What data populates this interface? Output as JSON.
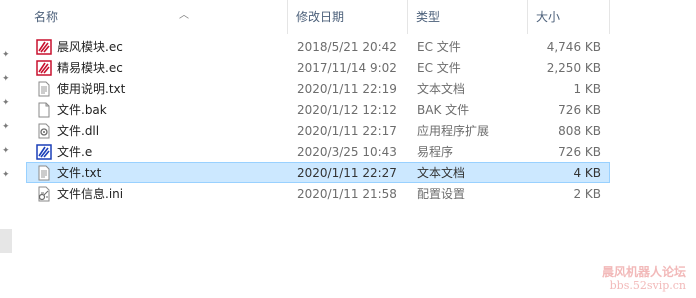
{
  "columns": {
    "name": "名称",
    "date": "修改日期",
    "type": "类型",
    "size": "大小"
  },
  "files": [
    {
      "name": "晨风模块.ec",
      "date": "2018/5/21 20:42",
      "type": "EC 文件",
      "size": "4,746 KB",
      "icon": "ec-module-icon",
      "selected": false
    },
    {
      "name": "精易模块.ec",
      "date": "2017/11/14 9:02",
      "type": "EC 文件",
      "size": "2,250 KB",
      "icon": "ec-module-icon",
      "selected": false
    },
    {
      "name": "使用说明.txt",
      "date": "2020/1/11 22:19",
      "type": "文本文档",
      "size": "1 KB",
      "icon": "text-document-icon",
      "selected": false
    },
    {
      "name": "文件.bak",
      "date": "2020/1/12 12:12",
      "type": "BAK 文件",
      "size": "726 KB",
      "icon": "blank-file-icon",
      "selected": false
    },
    {
      "name": "文件.dll",
      "date": "2020/1/11 22:17",
      "type": "应用程序扩展",
      "size": "808 KB",
      "icon": "dll-gear-icon",
      "selected": false
    },
    {
      "name": "文件.e",
      "date": "2020/3/25 10:43",
      "type": "易程序",
      "size": "726 KB",
      "icon": "e-source-icon",
      "selected": false
    },
    {
      "name": "文件.txt",
      "date": "2020/1/11 22:27",
      "type": "文本文档",
      "size": "4 KB",
      "icon": "text-document-icon",
      "selected": true
    },
    {
      "name": "文件信息.ini",
      "date": "2020/1/11 21:58",
      "type": "配置设置",
      "size": "2 KB",
      "icon": "ini-settings-icon",
      "selected": false
    }
  ],
  "watermark": {
    "line1": "晨风机器人论坛",
    "line2": "bbs.52svip.cn"
  },
  "colors": {
    "selection_bg": "#cce8ff",
    "selection_border": "#99d1ff",
    "header_text": "#4c607a",
    "ec_icon": "#c8102e",
    "e_icon": "#1a3fb8"
  }
}
